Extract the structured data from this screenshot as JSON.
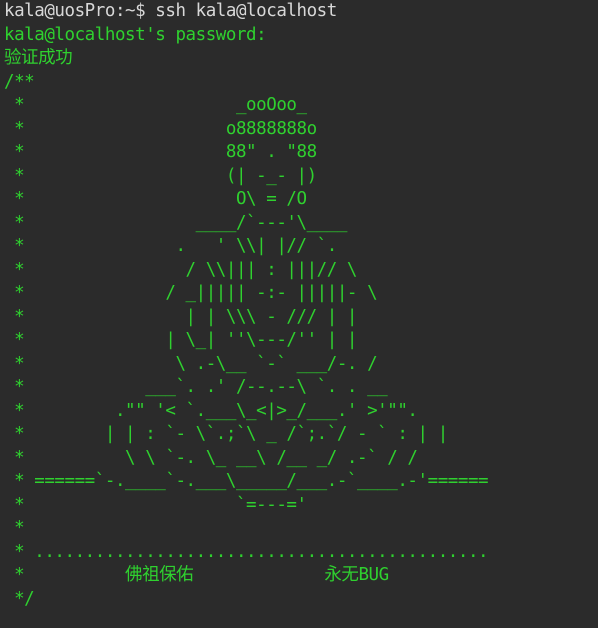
{
  "terminal": {
    "prompt_line": "kala@uosPro:~$ ssh kala@localhost",
    "password_line": "kala@localhost's password:",
    "auth_message": "验证成功",
    "banner": [
      "/**",
      " *                     _ooOoo_",
      " *                    o8888888o",
      " *                    88\" . \"88",
      " *                    (| -_- |)",
      " *                     O\\ = /O",
      " *                 ____/`---'\\____",
      " *               .   ' \\\\| |// `.",
      " *                / \\\\||| : |||// \\",
      " *              / _||||| -:- |||||- \\",
      " *                | | \\\\\\ - /// | |",
      " *              | \\_| ''\\---/'' | |",
      " *               \\ .-\\__ `-` ___/-. /",
      " *            ___`. .' /--.--\\ `. . __",
      " *         .\"\" '< `.___\\_<|>_/___.' >'\"\".",
      " *        | | : `- \\`.;`\\ _ /`;.`/ - ` : | |",
      " *          \\ \\ `-. \\_ __\\ /__ _/ .-` / /",
      " * ======`-.____`-.___\\_____/___.-`____.-'======",
      " *                     `=---='",
      " *",
      " * .............................................",
      " *          佛祖保佑             永无BUG",
      " */"
    ]
  }
}
